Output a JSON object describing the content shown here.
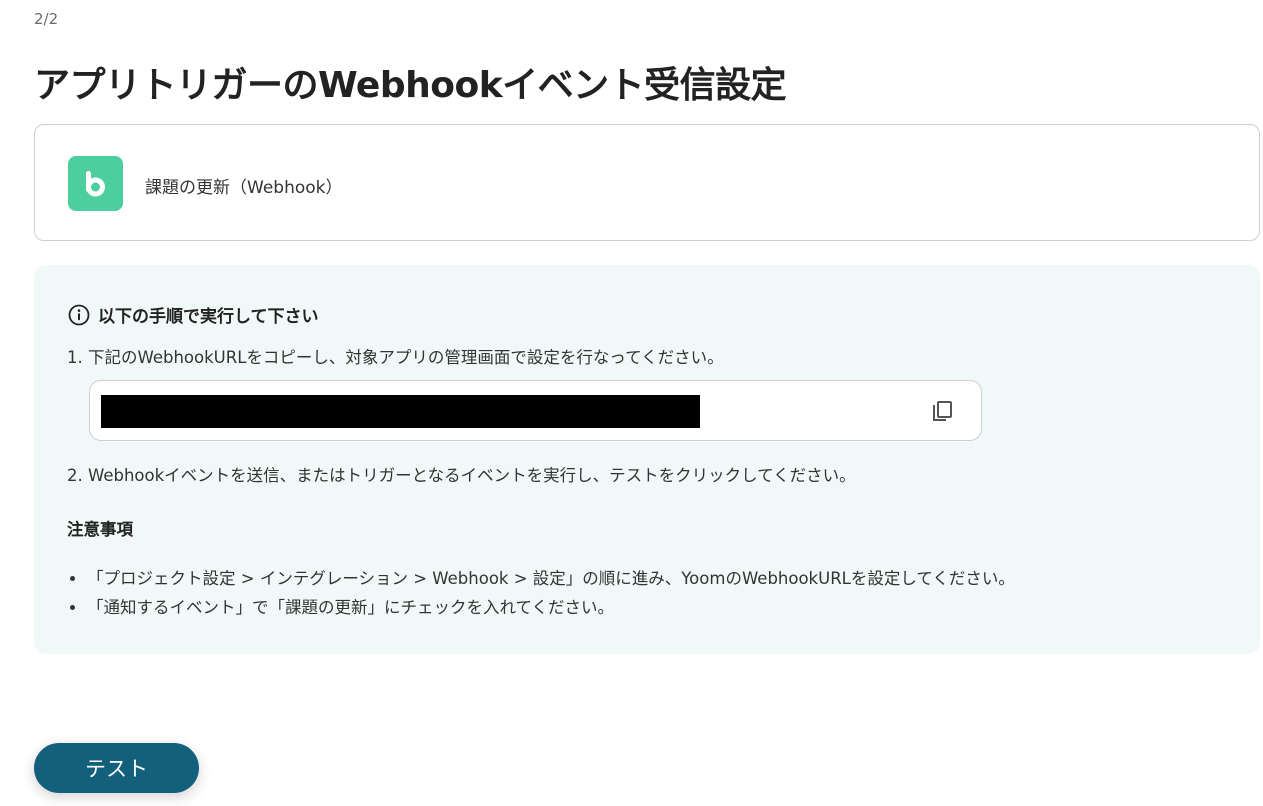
{
  "step_counter": "2/2",
  "page_title": "アプリトリガーのWebhookイベント受信設定",
  "trigger": {
    "app_icon": "backlog-logo-icon",
    "name": "課題の更新（Webhook）"
  },
  "instructions": {
    "heading": "以下の手順で実行して下さい",
    "heading_icon": "info-icon",
    "step1": "1. 下記のWebhookURLをコピーし、対象アプリの管理画面で設定を行なってください。",
    "webhook_url_redacted": true,
    "copy_icon": "copy-icon",
    "step2": "2. Webhookイベントを送信、またはトリガーとなるイベントを実行し、テストをクリックしてください。",
    "notes_heading": "注意事項",
    "notes": [
      "「プロジェクト設定 > インテグレーション > Webhook > 設定」の順に進み、YoomのWebhookURLを設定してください。",
      "「通知するイベント」で「課題の更新」にチェックを入れてください。"
    ]
  },
  "test_button_label": "テスト",
  "colors": {
    "app_logo": "#4cce9f",
    "panel_background": "#f1f9f8",
    "primary_button": "#13607c"
  }
}
